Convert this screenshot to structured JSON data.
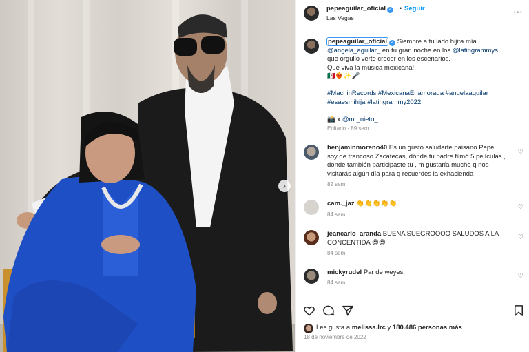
{
  "header": {
    "username": "pepeaguilar_oficial",
    "separator": "•",
    "follow_label": "Seguir",
    "location": "Las Vegas",
    "more_icon": "more-horizontal-icon"
  },
  "caption": {
    "username": "pepeaguilar_oficial",
    "text_1": "Siempre a tu lado hijita mía",
    "mention_1": "@angela_aguilar_",
    "text_2": "en tu gran noche en los",
    "mention_2": "@latingrammys",
    "text_3": ",",
    "line_3": "que orgullo verte crecer en los escenarios.",
    "line_4": "Que viva la música mexicana!!",
    "emojis": "🇲🇽❤️‍🔥✨🎤",
    "hashtags_1": "#MachinRecords #MexicanaEnamorada #angelaaguilar",
    "hashtags_2": "#esaesmihija #latingrammy2022",
    "credit_prefix": "📸 x",
    "credit_mention": "@mr_nieto_",
    "time": "Editado · 89 sem"
  },
  "comments": [
    {
      "username": "benjaminmoreno40",
      "text": "Es un gusto saludarte paisano Pepe , soy de trancoso Zacatecas, dónde tu padre filmó 5 películas , dónde también participaste tu , m gustaría mucho q nos visitarás algún día para q recuerdes la exhacienda",
      "time": "82 sem"
    },
    {
      "username": "cam._jaz",
      "text": "👏👏👏👏👏",
      "time": "84 sem"
    },
    {
      "username": "jeancarlo_aranda",
      "text": "BUENA SUEGROOOO SALUDOS A LA CONCENTIDA 😍😍",
      "time": "84 sem"
    },
    {
      "username": "mickyrudel",
      "text": "Par de weyes.",
      "time": "84 sem"
    }
  ],
  "likes": {
    "prefix": "Les gusta a",
    "user": "melissa.lrc",
    "middle": "y",
    "count": "180.486 personas",
    "suffix": "más"
  },
  "date": "18 de noviembre de 2022",
  "colors": {
    "accent": "#0095f6",
    "verified": "#3897f0",
    "dress": "#1f4fc4",
    "suit": "#1b1b1b"
  }
}
